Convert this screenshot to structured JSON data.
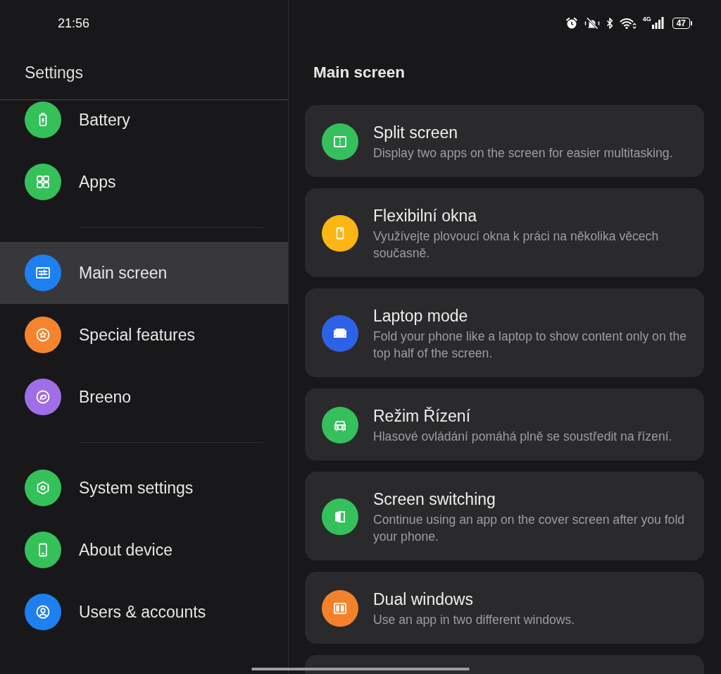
{
  "status_bar": {
    "time": "21:56",
    "network": "4G",
    "battery": "47"
  },
  "sidebar": {
    "title": "Settings",
    "groups": [
      {
        "items": [
          {
            "label": "Battery",
            "color": "#34c15a",
            "selected": false
          },
          {
            "label": "Apps",
            "color": "#34c15a",
            "selected": false
          }
        ]
      },
      {
        "items": [
          {
            "label": "Main screen",
            "color": "#1e80f0",
            "selected": true
          },
          {
            "label": "Special features",
            "color": "#f5842d",
            "selected": false
          },
          {
            "label": "Breeno",
            "color": "#a06ee6",
            "selected": false
          }
        ]
      },
      {
        "items": [
          {
            "label": "System settings",
            "color": "#34c15a",
            "selected": false
          },
          {
            "label": "About device",
            "color": "#34c15a",
            "selected": false
          },
          {
            "label": "Users & accounts",
            "color": "#1e80f0",
            "selected": false
          }
        ]
      }
    ]
  },
  "main": {
    "title": "Main screen",
    "cards": [
      {
        "title": "Split screen",
        "subtitle": "Display two apps on the screen for easier multitasking.",
        "color": "#35c05b"
      },
      {
        "title": "Flexibilní okna",
        "subtitle": "Využívejte plovoucí okna k práci na několika věcech současně.",
        "color": "#fbb614"
      },
      {
        "title": "Laptop mode",
        "subtitle": "Fold your phone like a laptop to show content only on the top half of the screen.",
        "color": "#2d62e8"
      },
      {
        "title": "Režim Řízení",
        "subtitle": "Hlasové ovládání pomáhá plně se soustředit na řízení.",
        "color": "#35c05b"
      },
      {
        "title": "Screen switching",
        "subtitle": "Continue using an app on the cover screen after you fold your phone.",
        "color": "#35c05b"
      },
      {
        "title": "Dual windows",
        "subtitle": "Use an app in two different windows.",
        "color": "#f5822b"
      }
    ]
  }
}
